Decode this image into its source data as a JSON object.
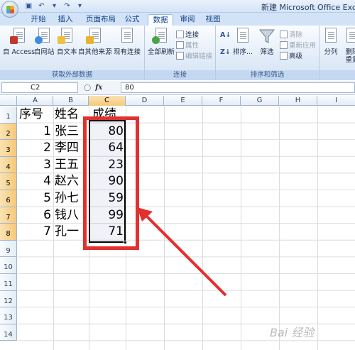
{
  "window": {
    "title": "新建 Microsoft Office Exce"
  },
  "tabs": [
    {
      "label": "开始"
    },
    {
      "label": "插入"
    },
    {
      "label": "页面布局"
    },
    {
      "label": "公式"
    },
    {
      "label": "数据",
      "active": true
    },
    {
      "label": "审阅"
    },
    {
      "label": "视图"
    }
  ],
  "ribbon": {
    "get_external": {
      "label": "获取外部数据",
      "from_access": "自 Access",
      "from_web": "自网站",
      "from_text": "自文本",
      "from_other": "自其他来源",
      "existing": "现有连接"
    },
    "connections": {
      "label": "连接",
      "refresh_all": "全部刷新",
      "connections": "连接",
      "properties": "属性",
      "edit_links": "编辑链接"
    },
    "sort_filter": {
      "label": "排序和筛选",
      "sort": "排序...",
      "filter": "筛选",
      "clear": "清除",
      "reapply": "重新应用",
      "advanced": "高级"
    },
    "data_tools": {
      "split": "分列",
      "remove_dup": "删除",
      "remove_dup2": "重复"
    }
  },
  "formula_bar": {
    "name_box": "C2",
    "fx": "fx",
    "content": "80"
  },
  "columns": [
    "A",
    "B",
    "C",
    "D",
    "E",
    "F",
    "G",
    "H",
    "I"
  ],
  "rows": [
    "1",
    "2",
    "3",
    "4",
    "5",
    "6",
    "7",
    "8",
    "9",
    "10",
    "11",
    "12",
    "13",
    "14"
  ],
  "sheet": {
    "header": {
      "seq": "序号",
      "name": "姓名",
      "score": "成绩"
    },
    "records": [
      {
        "seq": "1",
        "name": "张三",
        "score": "80"
      },
      {
        "seq": "2",
        "name": "李四",
        "score": "64"
      },
      {
        "seq": "3",
        "name": "王五",
        "score": "23"
      },
      {
        "seq": "4",
        "name": "赵六",
        "score": "90"
      },
      {
        "seq": "5",
        "name": "孙七",
        "score": "59"
      },
      {
        "seq": "6",
        "name": "钱八",
        "score": "99"
      },
      {
        "seq": "7",
        "name": "孔一",
        "score": "71"
      }
    ]
  },
  "watermark": "Bai 经验",
  "colors": {
    "highlight": "#e0302f",
    "selection_header": "#f6c878",
    "ribbon": "#d5e3f5"
  }
}
